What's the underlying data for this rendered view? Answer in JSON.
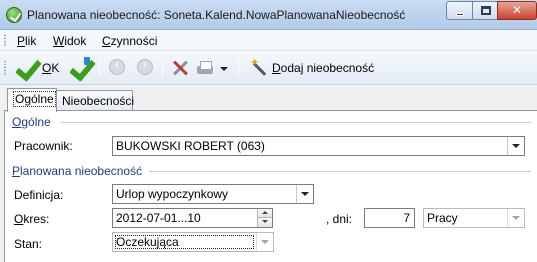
{
  "window": {
    "title": "Planowana nieobecność: Soneta.Kalend.NowaPlanowanaNieobecność",
    "minimize_glyph": "",
    "maximize_glyph": "",
    "close_glyph": "✕"
  },
  "menu": {
    "items": [
      {
        "accel": "P",
        "rest": "lik"
      },
      {
        "accel": "W",
        "rest": "idok"
      },
      {
        "accel": "C",
        "rest": "zynności"
      }
    ]
  },
  "toolbar": {
    "ok_accel": "O",
    "ok_rest": "K",
    "add_accel": "D",
    "add_rest": "odaj nieobecność"
  },
  "tabs": [
    {
      "label": "Ogólne",
      "active": true
    },
    {
      "label": "Nieobecności",
      "active": false
    }
  ],
  "general_group": {
    "header_accel": "O",
    "header_rest": "gólne",
    "employee_label": "Pracownik:",
    "employee_value": "BUKOWSKI ROBERT (063)"
  },
  "planned_group": {
    "header_accel": "P",
    "header_rest": "lanowana nieobecność",
    "definition_label": "Definicja:",
    "definition_value": "Urlop wypoczynkowy",
    "period_label_accel": "O",
    "period_label_rest": "kres:",
    "period_value": "2012-07-01...10",
    "days_label": ", dni:",
    "days_value": "7",
    "day_type_value": "Pracy",
    "status_label": "Stan:",
    "status_value": "Oczekująca"
  }
}
